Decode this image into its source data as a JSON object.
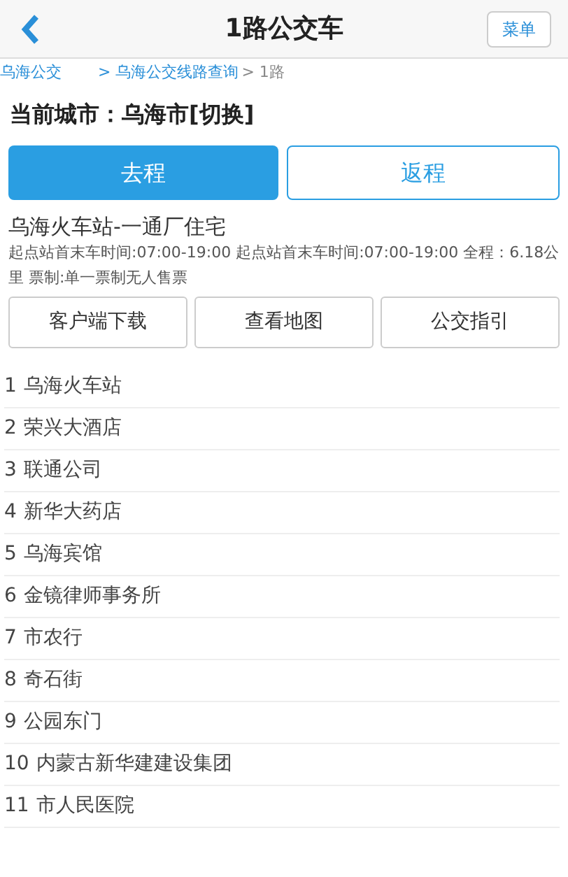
{
  "header": {
    "title": "1路公交车",
    "menu_button": "菜单"
  },
  "breadcrumb": [
    "乌海公交",
    "> 乌海公交线路查询",
    "> 1路"
  ],
  "city": "当前城市：乌海市[切换]",
  "tabs": [
    {
      "label": "去程",
      "selected": true
    },
    {
      "label": "返程",
      "selected": false
    }
  ],
  "route": {
    "name": "乌海火车站-一通厂住宅",
    "info": "起点站首末车时间:07:00-19:00 起点站首末车时间:07:00-19:00 全程：6.18公里 票制:单一票制无人售票"
  },
  "actions": [
    "客户端下载",
    "查看地图",
    "公交指引"
  ],
  "stops": [
    {
      "number": "1",
      "name": "乌海火车站"
    },
    {
      "number": "2",
      "name": "荣兴大酒店"
    },
    {
      "number": "3",
      "name": "联通公司"
    },
    {
      "number": "4",
      "name": "新华大药店"
    },
    {
      "number": "5",
      "name": "乌海宾馆"
    },
    {
      "number": "6",
      "name": "金镜律师事务所"
    },
    {
      "number": "7",
      "name": "市农行"
    },
    {
      "number": "8",
      "name": "奇石街"
    },
    {
      "number": "9",
      "name": "公园东门"
    },
    {
      "number": "10",
      "name": "内蒙古新华建建设集团"
    },
    {
      "number": "11",
      "name": "市人民医院"
    }
  ]
}
